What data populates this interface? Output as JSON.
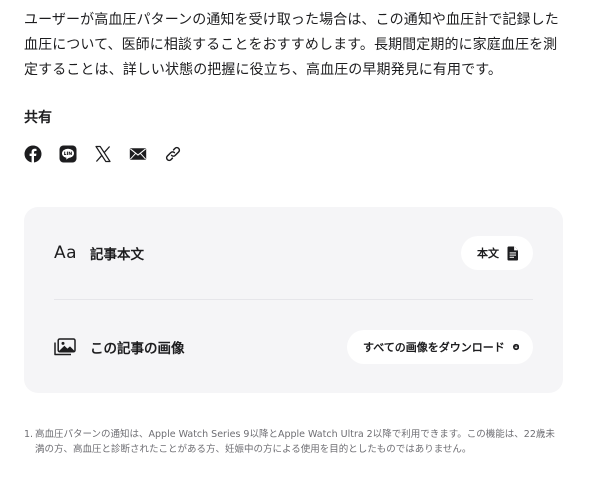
{
  "article": {
    "body_text": "ユーザーが高血圧パターンの通知を受け取った場合は、この通知や血圧計で記録した血圧について、医師に相談することをおすすめします。長期間定期的に家庭血圧を測定することは、詳しい状態の把握に役立ち、高血圧の早期発見に有用です。"
  },
  "share": {
    "title": "共有",
    "icons": [
      "facebook-icon",
      "line-icon",
      "x-icon",
      "mail-icon",
      "link-icon"
    ]
  },
  "resources": {
    "article_text": {
      "glyph": "Aa",
      "label": "記事本文",
      "button_label": "本文"
    },
    "images": {
      "label": "この記事の画像",
      "button_label": "すべての画像をダウンロード"
    }
  },
  "footnotes": [
    {
      "number": "1.",
      "text": "高血圧パターンの通知は、Apple Watch Series 9以降とApple Watch Ultra 2以降で利用できます。この機能は、22歳未満の方、高血圧と診断されたことがある方、妊娠中の方による使用を目的としたものではありません。"
    }
  ],
  "colors": {
    "text": "#1d1d1f",
    "card_background": "#f5f5f7",
    "footnote_text": "#6e6e73"
  }
}
